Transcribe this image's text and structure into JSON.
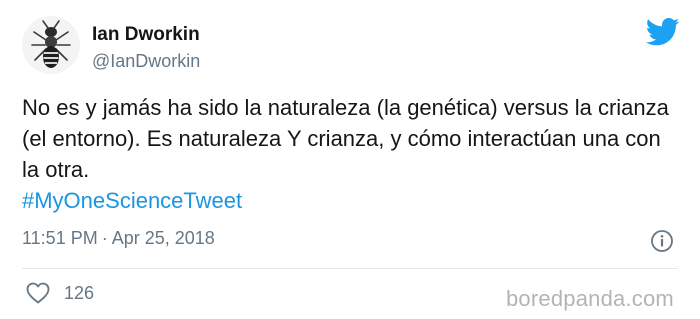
{
  "author": {
    "name": "Ian Dworkin",
    "handle": "@IanDworkin",
    "avatar_icon": "wasp-avatar"
  },
  "brand": {
    "icon": "twitter-bird-icon",
    "color": "#1da1f2"
  },
  "tweet": {
    "text": "No es y jamás ha sido la naturaleza (la genética) versus la crianza (el entorno). Es naturaleza Y crianza, y cómo interactúan una con la otra.",
    "hashtag": "#MyOneScienceTweet",
    "hashtag_color": "#1b95e0"
  },
  "meta": {
    "time": "11:51 PM",
    "separator": "·",
    "date": "Apr 25, 2018"
  },
  "actions": {
    "like_icon": "heart-icon",
    "like_count": "126",
    "info_icon": "info-icon"
  },
  "watermark": "boredpanda.com"
}
